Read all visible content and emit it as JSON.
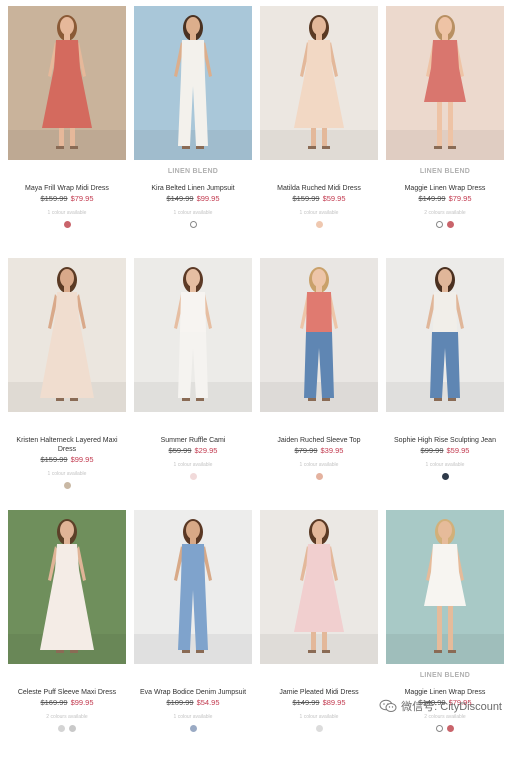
{
  "products": [
    {
      "badge": "",
      "name": "Maya Frill Wrap Midi Dress",
      "was": "$159.99",
      "now": "$79.95",
      "avail": "1 colour available",
      "swatches": [
        "#c9646b"
      ],
      "bg": "#c9b39b",
      "garment": "#d46a5e",
      "skin": "#e6b89a",
      "hair": "#8a5a36",
      "style": "dress"
    },
    {
      "badge": "LINEN BLEND",
      "name": "Kira Belted Linen Jumpsuit",
      "was": "$149.99",
      "now": "$99.95",
      "avail": "1 colour available",
      "swatches": [
        "#ffffff"
      ],
      "bg": "#a9c7d9",
      "garment": "#f3f1ec",
      "skin": "#dcae8c",
      "hair": "#4a3222",
      "style": "jumpsuit"
    },
    {
      "badge": "",
      "name": "Matilda Ruched Midi Dress",
      "was": "$159.99",
      "now": "$59.95",
      "avail": "1 colour available",
      "swatches": [
        "#efc8b0"
      ],
      "bg": "#ece7e1",
      "garment": "#f2d8c4",
      "skin": "#e3b89a",
      "hair": "#5a3a24",
      "style": "dress"
    },
    {
      "badge": "LINEN BLEND",
      "name": "Maggie Linen Wrap Dress",
      "was": "$149.99",
      "now": "$79.95",
      "avail": "2 colours available",
      "swatches": [
        "#ffffff",
        "#c9646b"
      ],
      "bg": "#ecd9cd",
      "garment": "#d9766e",
      "skin": "#eec3a5",
      "hair": "#b89063",
      "style": "short"
    },
    {
      "badge": "",
      "name": "Kristen Halterneck Layered Maxi Dress",
      "was": "$159.99",
      "now": "$99.95",
      "avail": "1 colour available",
      "swatches": [
        "#c9b8a4"
      ],
      "bg": "#ebe6df",
      "garment": "#f0ddcf",
      "skin": "#d9a98a",
      "hair": "#5a3a24",
      "style": "maxi"
    },
    {
      "badge": "",
      "name": "Summer Ruffle Cami",
      "was": "$59.99",
      "now": "$29.95",
      "avail": "1 colour available",
      "swatches": [
        "#f1dada"
      ],
      "bg": "#ecebe8",
      "garment": "#f7f4f1",
      "skin": "#e6bea2",
      "hair": "#5c3a26",
      "style": "top"
    },
    {
      "badge": "",
      "name": "Jaiden Ruched Sleeve Top",
      "was": "$79.99",
      "now": "$39.95",
      "avail": "1 colour available",
      "swatches": [
        "#e4b29f"
      ],
      "bg": "#e9e6e3",
      "garment": "#e07a70",
      "skin": "#edc5a8",
      "hair": "#c9a16a",
      "style": "topjeans"
    },
    {
      "badge": "",
      "name": "Sophie High Rise Sculpting Jean",
      "was": "$99.99",
      "now": "$59.95",
      "avail": "1 colour available",
      "swatches": [
        "#2f3a4a"
      ],
      "bg": "#ecebe9",
      "garment": "#5a7fa8",
      "skin": "#e0b699",
      "hair": "#4a3020",
      "style": "jeans"
    },
    {
      "badge": "",
      "name": "Celeste Puff Sleeve Maxi Dress",
      "was": "$169.99",
      "now": "$99.95",
      "avail": "2 colours available",
      "swatches": [
        "#d4d4d4",
        "#c9c9c9"
      ],
      "bg": "#6f8f5c",
      "garment": "#f4ece6",
      "skin": "#e0b497",
      "hair": "#5c4028",
      "style": "maxi"
    },
    {
      "badge": "",
      "name": "Eva Wrap Bodice Denim Jumpsuit",
      "was": "$109.99",
      "now": "$54.95",
      "avail": "1 colour available",
      "swatches": [
        "#9aaac4"
      ],
      "bg": "#ededec",
      "garment": "#7fa3cc",
      "skin": "#d8a987",
      "hair": "#5a3824",
      "style": "jumpsuit"
    },
    {
      "badge": "",
      "name": "Jamie Pleated Midi Dress",
      "was": "$149.99",
      "now": "$89.95",
      "avail": "1 colour available",
      "swatches": [
        "#dcdcdc"
      ],
      "bg": "#ebe8e4",
      "garment": "#f1cfcf",
      "skin": "#e3b89a",
      "hair": "#5a3a24",
      "style": "dress"
    },
    {
      "badge": "LINEN BLEND",
      "name": "Maggie Linen Wrap Dress",
      "was": "$149.99",
      "now": "$79.95",
      "avail": "2 colours available",
      "swatches": [
        "#ffffff",
        "#c9646b"
      ],
      "bg": "#a8c9c6",
      "garment": "#f7f5f1",
      "skin": "#e6bb9a",
      "hair": "#d2b07a",
      "style": "short"
    }
  ],
  "watermark": {
    "text": "微信号: CityDiscount"
  }
}
